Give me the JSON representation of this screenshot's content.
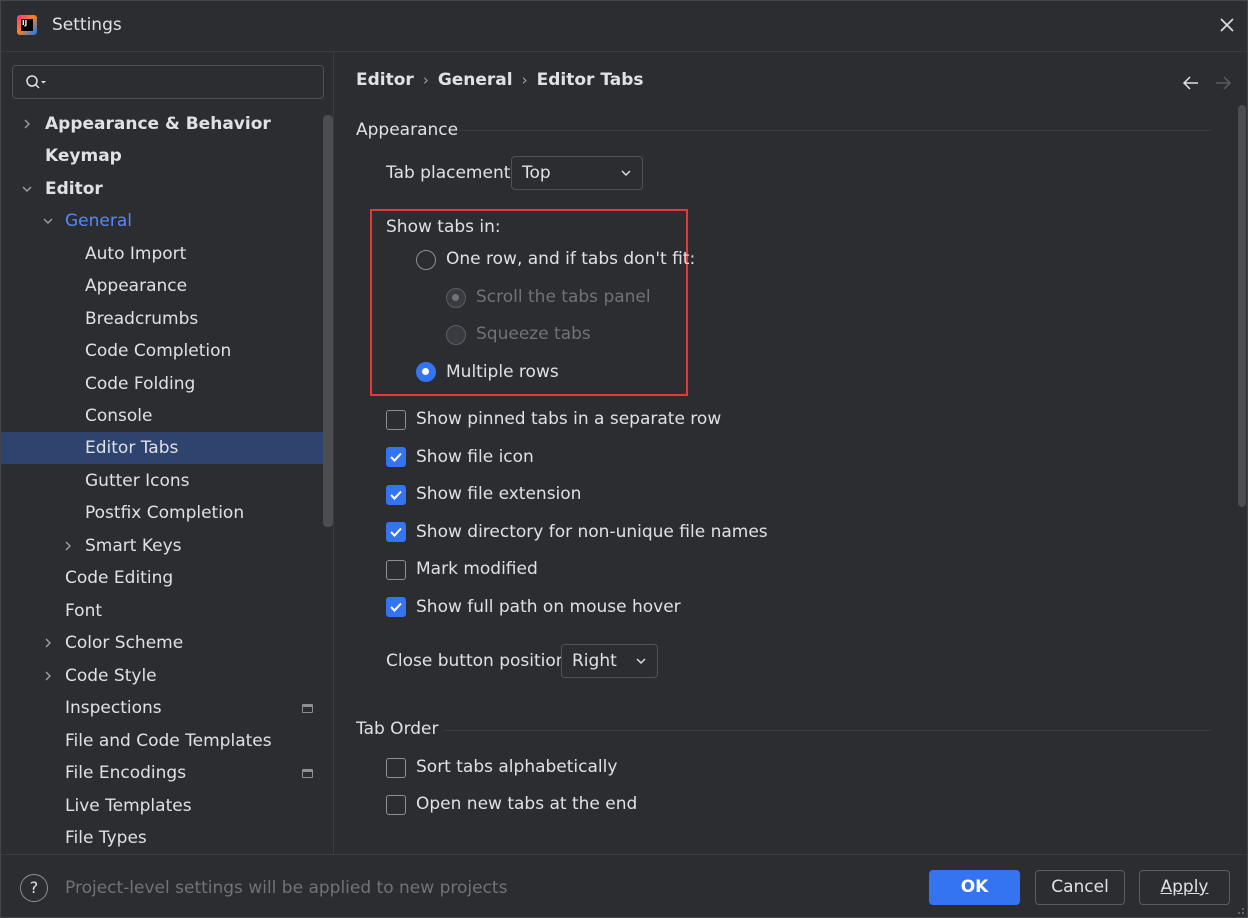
{
  "window": {
    "title": "Settings"
  },
  "search": {
    "value": "",
    "placeholder": ""
  },
  "tree": [
    {
      "label": "Appearance & Behavior",
      "chevron": "right"
    },
    {
      "label": "Keymap"
    },
    {
      "label": "Editor",
      "chevron": "down"
    },
    {
      "label": "General",
      "chevron": "down"
    },
    {
      "label": "Auto Import"
    },
    {
      "label": "Appearance"
    },
    {
      "label": "Breadcrumbs"
    },
    {
      "label": "Code Completion"
    },
    {
      "label": "Code Folding"
    },
    {
      "label": "Console"
    },
    {
      "label": "Editor Tabs",
      "selected": true
    },
    {
      "label": "Gutter Icons"
    },
    {
      "label": "Postfix Completion"
    },
    {
      "label": "Smart Keys",
      "chevron": "right"
    },
    {
      "label": "Code Editing"
    },
    {
      "label": "Font"
    },
    {
      "label": "Color Scheme",
      "chevron": "right"
    },
    {
      "label": "Code Style",
      "chevron": "right"
    },
    {
      "label": "Inspections",
      "badge": "project-scope-icon"
    },
    {
      "label": "File and Code Templates"
    },
    {
      "label": "File Encodings",
      "badge": "project-scope-icon"
    },
    {
      "label": "Live Templates"
    },
    {
      "label": "File Types"
    }
  ],
  "breadcrumb": {
    "items": [
      "Editor",
      "General",
      "Editor Tabs"
    ]
  },
  "appearance": {
    "title": "Appearance",
    "tab_placement_label": "Tab placement:",
    "tab_placement_value": "Top",
    "show_tabs_in_label": "Show tabs in:",
    "radios": [
      {
        "label": "One row, and if tabs don't fit:",
        "selected": false,
        "enabled": true
      },
      {
        "label": "Scroll the tabs panel",
        "selected": true,
        "enabled": false
      },
      {
        "label": "Squeeze tabs",
        "selected": false,
        "enabled": false
      },
      {
        "label": "Multiple rows",
        "selected": true,
        "enabled": true
      }
    ],
    "checkboxes": [
      {
        "label": "Show pinned tabs in a separate row",
        "checked": false
      },
      {
        "label": "Show file icon",
        "checked": true
      },
      {
        "label": "Show file extension",
        "checked": true
      },
      {
        "label": "Show directory for non-unique file names",
        "checked": true
      },
      {
        "label": "Mark modified",
        "checked": false
      },
      {
        "label": "Show full path on mouse hover",
        "checked": true
      }
    ],
    "close_button_label": "Close button position:",
    "close_button_value": "Right"
  },
  "tab_order": {
    "title": "Tab Order",
    "checkboxes": [
      {
        "label": "Sort tabs alphabetically",
        "checked": false
      },
      {
        "label": "Open new tabs at the end",
        "checked": false
      }
    ]
  },
  "footer": {
    "help_label": "?",
    "note": "Project-level settings will be applied to new projects",
    "ok_label": "OK",
    "cancel_label": "Cancel",
    "apply_label": "Apply"
  },
  "colors": {
    "accent": "#3574f0",
    "selection": "#2e436e",
    "highlight_box": "#e5383b",
    "background": "#2b2d30"
  }
}
